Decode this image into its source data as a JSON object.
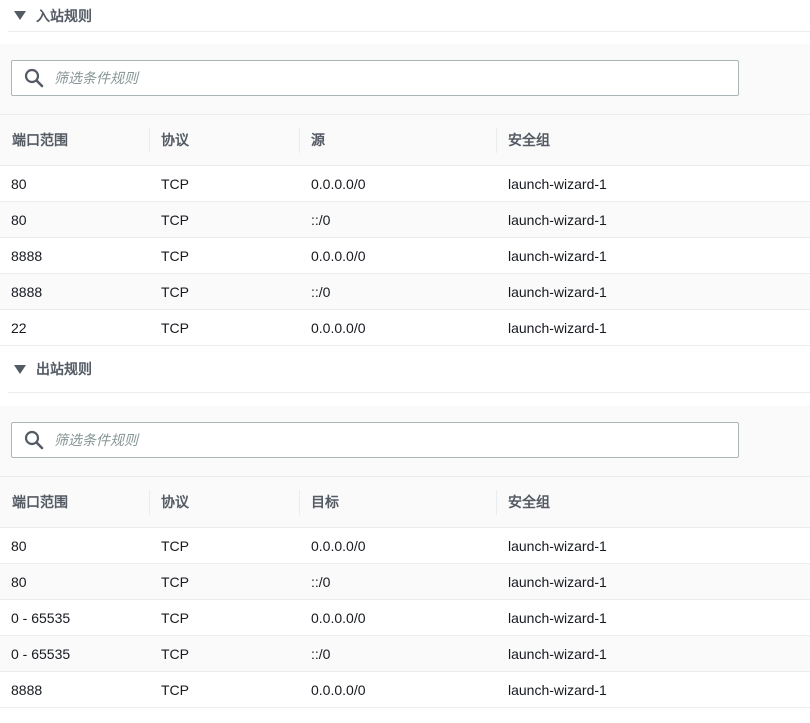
{
  "inbound": {
    "title": "入站规则",
    "filter_placeholder": "筛选条件规则",
    "columns": [
      "端口范围",
      "协议",
      "源",
      "安全组"
    ],
    "rows": [
      {
        "port": "80",
        "protocol": "TCP",
        "source": "0.0.0.0/0",
        "group": "launch-wizard-1"
      },
      {
        "port": "80",
        "protocol": "TCP",
        "source": "::/0",
        "group": "launch-wizard-1"
      },
      {
        "port": "8888",
        "protocol": "TCP",
        "source": "0.0.0.0/0",
        "group": "launch-wizard-1"
      },
      {
        "port": "8888",
        "protocol": "TCP",
        "source": "::/0",
        "group": "launch-wizard-1"
      },
      {
        "port": "22",
        "protocol": "TCP",
        "source": "0.0.0.0/0",
        "group": "launch-wizard-1"
      }
    ]
  },
  "outbound": {
    "title": "出站规则",
    "filter_placeholder": "筛选条件规则",
    "columns": [
      "端口范围",
      "协议",
      "目标",
      "安全组"
    ],
    "rows": [
      {
        "port": "80",
        "protocol": "TCP",
        "source": "0.0.0.0/0",
        "group": "launch-wizard-1"
      },
      {
        "port": "80",
        "protocol": "TCP",
        "source": "::/0",
        "group": "launch-wizard-1"
      },
      {
        "port": "0 - 65535",
        "protocol": "TCP",
        "source": "0.0.0.0/0",
        "group": "launch-wizard-1"
      },
      {
        "port": "0 - 65535",
        "protocol": "TCP",
        "source": "::/0",
        "group": "launch-wizard-1"
      },
      {
        "port": "8888",
        "protocol": "TCP",
        "source": "0.0.0.0/0",
        "group": "launch-wizard-1"
      }
    ]
  },
  "icons": {
    "caret": "caret-down-icon",
    "search": "search-icon"
  }
}
